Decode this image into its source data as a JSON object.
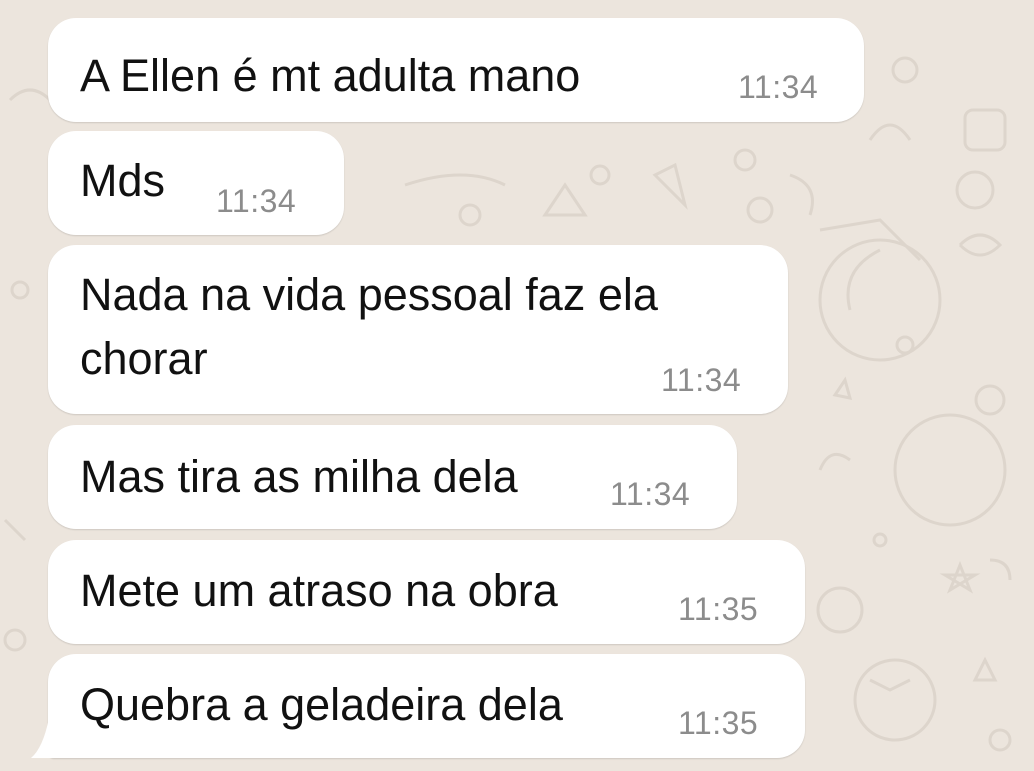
{
  "theme": {
    "wallpaper_color": "#ece5dd",
    "bubble_color": "#ffffff",
    "text_color": "#111111",
    "time_color": "#8c8c8c"
  },
  "messages": [
    {
      "text": "A Ellen é mt adulta mano",
      "time": "11:34"
    },
    {
      "text": "Mds",
      "time": "11:34"
    },
    {
      "text": "Nada na vida pessoal faz ela\nchorar",
      "time": "11:34"
    },
    {
      "text": "Mas tira as milha dela",
      "time": "11:34"
    },
    {
      "text": "Mete um atraso na obra",
      "time": "11:35"
    },
    {
      "text": "Quebra a geladeira dela",
      "time": "11:35"
    }
  ]
}
